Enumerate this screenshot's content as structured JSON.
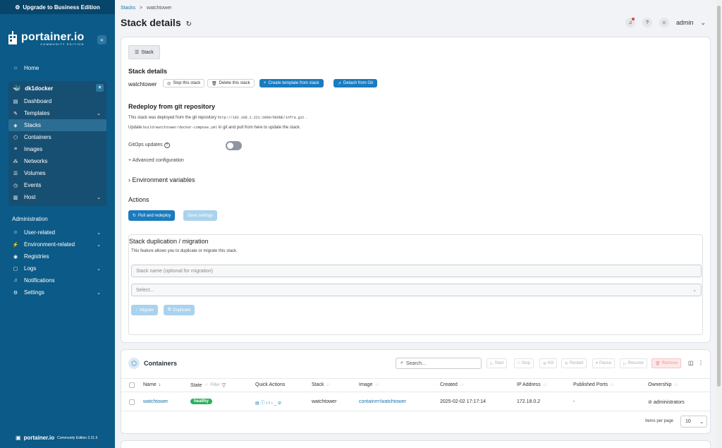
{
  "sidebar": {
    "upgrade": "Upgrade to Business Edition",
    "logo": "portainer.io",
    "logo_sub": "COMMUNITY EDITION",
    "home": "Home",
    "environment": "dk1docker",
    "env_items": [
      "Dashboard",
      "Templates",
      "Stacks",
      "Containers",
      "Images",
      "Networks",
      "Volumes",
      "Events",
      "Host"
    ],
    "admin_label": "Administration",
    "admin_items": [
      "User-related",
      "Environment-related",
      "Registries",
      "Logs",
      "Notifications",
      "Settings"
    ],
    "footer_logo": "portainer.io",
    "footer_version": "Community Edition 2.21.5"
  },
  "header": {
    "breadcrumb_root": "Stacks",
    "breadcrumb_sep": ">",
    "breadcrumb_current": "watchtower",
    "title": "Stack details",
    "user": "admin"
  },
  "stack": {
    "tab": "Stack",
    "section_title": "Stack details",
    "name": "watchtower",
    "stop": "Stop this stack",
    "delete": "Delete this stack",
    "create_template": "Create template from stack",
    "detach": "Detach from Git",
    "redeploy_title": "Redeploy from git repository",
    "repo_text_pre": "This stack was deployed from the git repository",
    "repo_url": "http://192.168.1.221:3000/DKONE/infra.git",
    "repo_text_post": ".",
    "update_pre": "Update",
    "compose_path": "build/watchtower/docker-compose.yml",
    "update_post": "in git and pull from here to update the stack.",
    "gitops": "GitOps updates",
    "advanced": "Advanced configuration",
    "env_vars": "Environment variables",
    "actions": "Actions",
    "pull_redeploy": "Pull and redeploy",
    "save_settings": "Save settings",
    "dup_title": "Stack duplication / migration",
    "dup_desc": "This feature allows you to duplicate or migrate this stack.",
    "stack_name_placeholder": "Stack name (optional for migration)",
    "select_placeholder": "Select...",
    "migrate": "Migrate",
    "duplicate": "Duplicate"
  },
  "containers": {
    "title": "Containers",
    "search_placeholder": "Search...",
    "tools": [
      "Start",
      "Stop",
      "Kill",
      "Restart",
      "Pause",
      "Resume",
      "Remove"
    ],
    "columns": [
      "Name",
      "State",
      "Filter",
      "Quick Actions",
      "Stack",
      "Image",
      "Created",
      "IP Address",
      "Published Ports",
      "Ownership"
    ],
    "rows": [
      {
        "name": "watchtower",
        "state": "healthy",
        "stack": "watchtower",
        "image": "containrrr/watchtower",
        "created": "2025-02-02 17:17:14",
        "ip": "172.18.0.2",
        "ports": "-",
        "ownership": "administrators"
      }
    ],
    "items_per_page_label": "Items per page",
    "items_per_page": "10"
  }
}
